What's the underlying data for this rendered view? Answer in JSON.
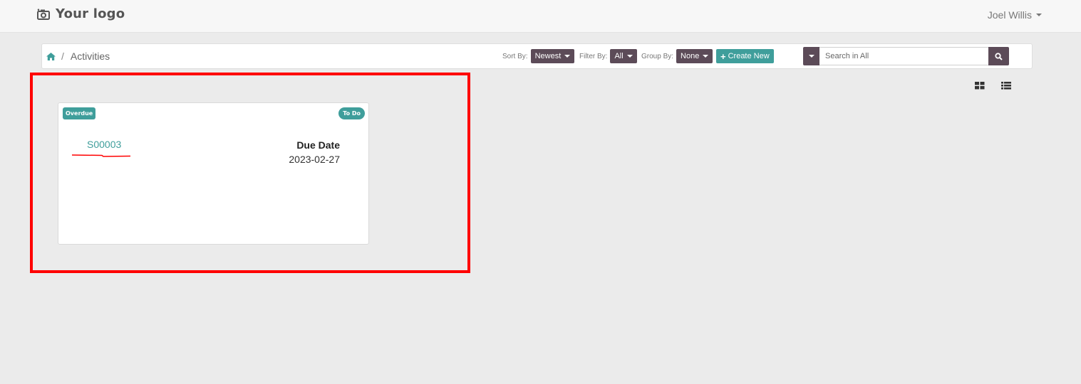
{
  "header": {
    "logo_text": "Your logo",
    "logo_icon": "camera-icon",
    "user_name": "Joel Willis"
  },
  "breadcrumb": {
    "home_icon": "home-icon",
    "separator": "/",
    "current": "Activities"
  },
  "controls": {
    "sort_label": "Sort By:",
    "sort_value": "Newest",
    "filter_label": "Filter By:",
    "filter_value": "All",
    "group_label": "Group By:",
    "group_value": "None",
    "create_label": "Create New",
    "search_placeholder": "Search in All",
    "search_icon": "search-icon"
  },
  "view_switch": {
    "grid_icon": "grid-view-icon",
    "list_icon": "list-view-icon"
  },
  "cards": [
    {
      "status_badge": "Overdue",
      "type_badge": "To Do",
      "reference": "S00003",
      "due_label": "Due Date",
      "due_date": "2023-02-27"
    }
  ],
  "colors": {
    "accent_teal": "#3f9e9b",
    "control_purple": "#5c4b58",
    "highlight_red": "#ff0000",
    "background": "#ebebeb"
  }
}
